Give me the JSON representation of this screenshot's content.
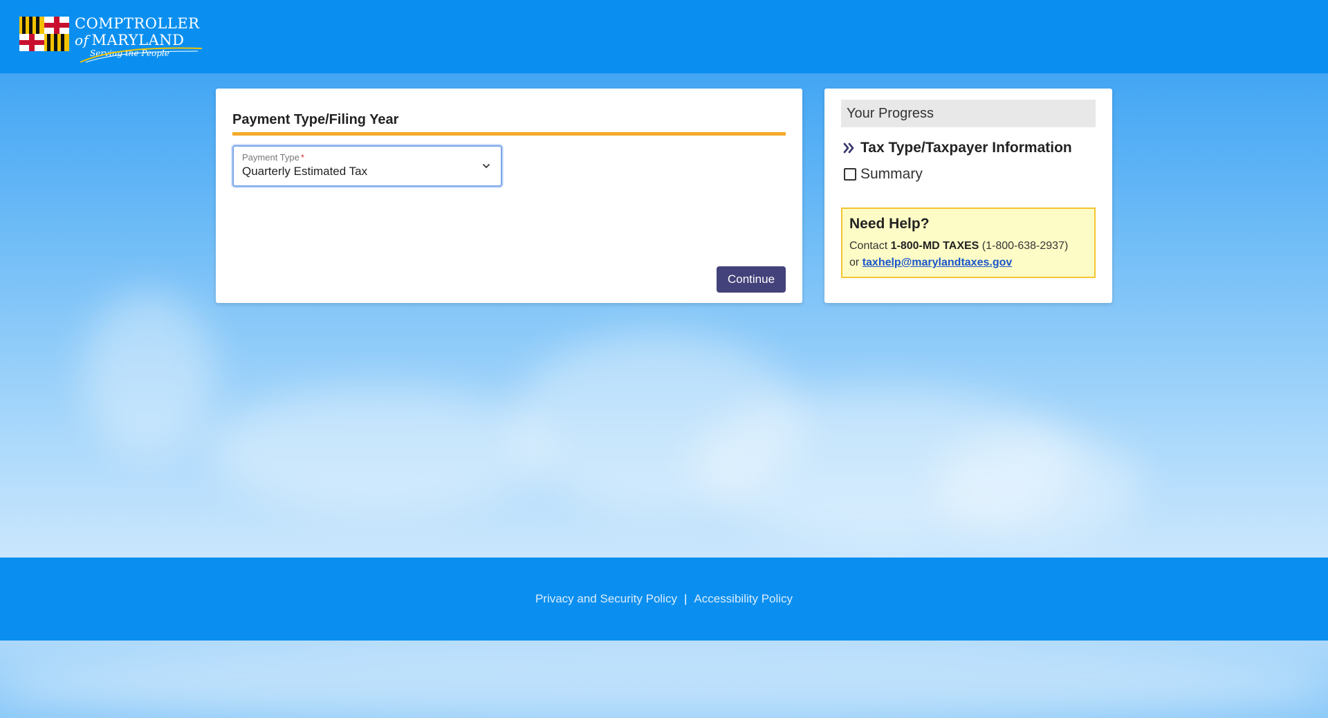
{
  "header": {
    "logo_line1": "COMPTROLLER",
    "logo_line2_of": "of",
    "logo_line2": "MARYLAND",
    "logo_tagline": "Serving the People"
  },
  "main": {
    "section_title": "Payment Type/Filing Year",
    "payment_type": {
      "label": "Payment Type",
      "required_mark": "*",
      "selected_value": "Quarterly Estimated Tax"
    },
    "continue_label": "Continue"
  },
  "progress": {
    "title": "Your Progress",
    "steps": [
      {
        "label": "Tax Type/Taxpayer Information",
        "state": "current"
      },
      {
        "label": "Summary",
        "state": "pending"
      }
    ]
  },
  "help": {
    "title": "Need Help?",
    "contact_prefix": "Contact",
    "phone_name": "1-800-MD TAXES",
    "phone_number": "(1-800-638-2937)",
    "or_text": "or",
    "email": "taxhelp@marylandtaxes.gov"
  },
  "footer": {
    "privacy_link": "Privacy and Security Policy",
    "separator": "|",
    "accessibility_link": "Accessibility Policy"
  },
  "colors": {
    "header_blue": "#0a8ff0",
    "accent_orange": "#f4ab2a",
    "button_purple": "#44427a",
    "help_yellow": "#fefcc6",
    "link_blue": "#1a55c9"
  }
}
